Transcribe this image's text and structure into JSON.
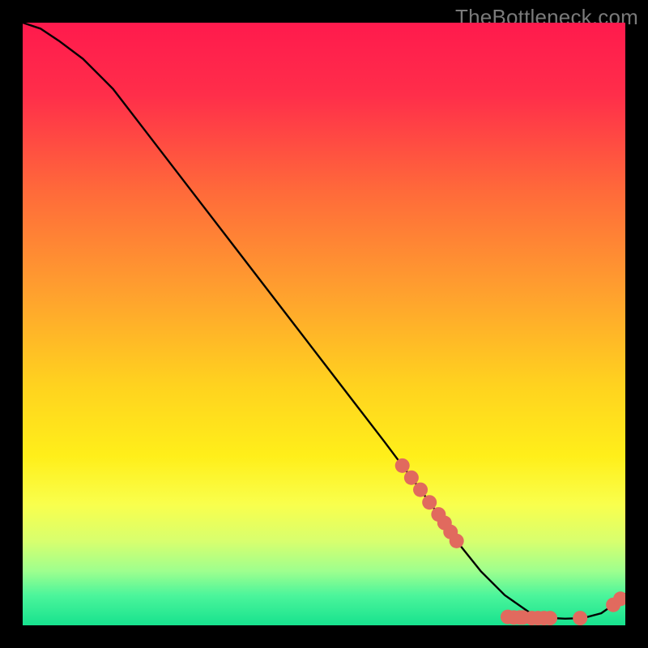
{
  "watermark": "TheBottleneck.com",
  "chart_data": {
    "type": "line",
    "title": "",
    "xlabel": "",
    "ylabel": "",
    "xlim": [
      0,
      100
    ],
    "ylim": [
      0,
      100
    ],
    "grid": false,
    "legend": false,
    "background_gradient": {
      "stops": [
        {
          "offset": 0.0,
          "color": "#ff1a4d"
        },
        {
          "offset": 0.12,
          "color": "#ff2e4a"
        },
        {
          "offset": 0.28,
          "color": "#ff6a3a"
        },
        {
          "offset": 0.45,
          "color": "#ffa12e"
        },
        {
          "offset": 0.6,
          "color": "#ffd21f"
        },
        {
          "offset": 0.72,
          "color": "#ffef1a"
        },
        {
          "offset": 0.8,
          "color": "#f9ff4d"
        },
        {
          "offset": 0.86,
          "color": "#d8ff6e"
        },
        {
          "offset": 0.91,
          "color": "#9eff8e"
        },
        {
          "offset": 0.95,
          "color": "#4cf59b"
        },
        {
          "offset": 1.0,
          "color": "#17e28e"
        }
      ]
    },
    "series": [
      {
        "name": "bottleneck-curve",
        "color": "#000000",
        "x": [
          0,
          3,
          6,
          10,
          15,
          20,
          25,
          30,
          35,
          40,
          45,
          50,
          55,
          60,
          63,
          66,
          70,
          72,
          76,
          80,
          84,
          88,
          90,
          93,
          96,
          98,
          100
        ],
        "y": [
          100,
          99,
          97,
          94,
          89,
          82.5,
          76,
          69.5,
          63,
          56.5,
          50,
          43.5,
          37,
          30.5,
          26.5,
          22.5,
          17,
          14,
          9,
          5,
          2.2,
          1.2,
          1.1,
          1.2,
          2.0,
          3.4,
          5.2
        ]
      }
    ],
    "markers": {
      "name": "highlight-points",
      "color": "#e16a5e",
      "radius": 9,
      "points": [
        {
          "x": 63.0,
          "y": 26.5
        },
        {
          "x": 64.5,
          "y": 24.5
        },
        {
          "x": 66.0,
          "y": 22.5
        },
        {
          "x": 67.5,
          "y": 20.4
        },
        {
          "x": 69.0,
          "y": 18.4
        },
        {
          "x": 70.0,
          "y": 17.0
        },
        {
          "x": 71.0,
          "y": 15.5
        },
        {
          "x": 72.0,
          "y": 14.0
        },
        {
          "x": 80.5,
          "y": 1.4
        },
        {
          "x": 81.5,
          "y": 1.3
        },
        {
          "x": 82.5,
          "y": 1.3
        },
        {
          "x": 83.0,
          "y": 1.3
        },
        {
          "x": 84.5,
          "y": 1.2
        },
        {
          "x": 85.5,
          "y": 1.2
        },
        {
          "x": 86.5,
          "y": 1.2
        },
        {
          "x": 87.5,
          "y": 1.2
        },
        {
          "x": 92.5,
          "y": 1.2
        },
        {
          "x": 98.0,
          "y": 3.4
        },
        {
          "x": 99.2,
          "y": 4.4
        }
      ]
    }
  }
}
